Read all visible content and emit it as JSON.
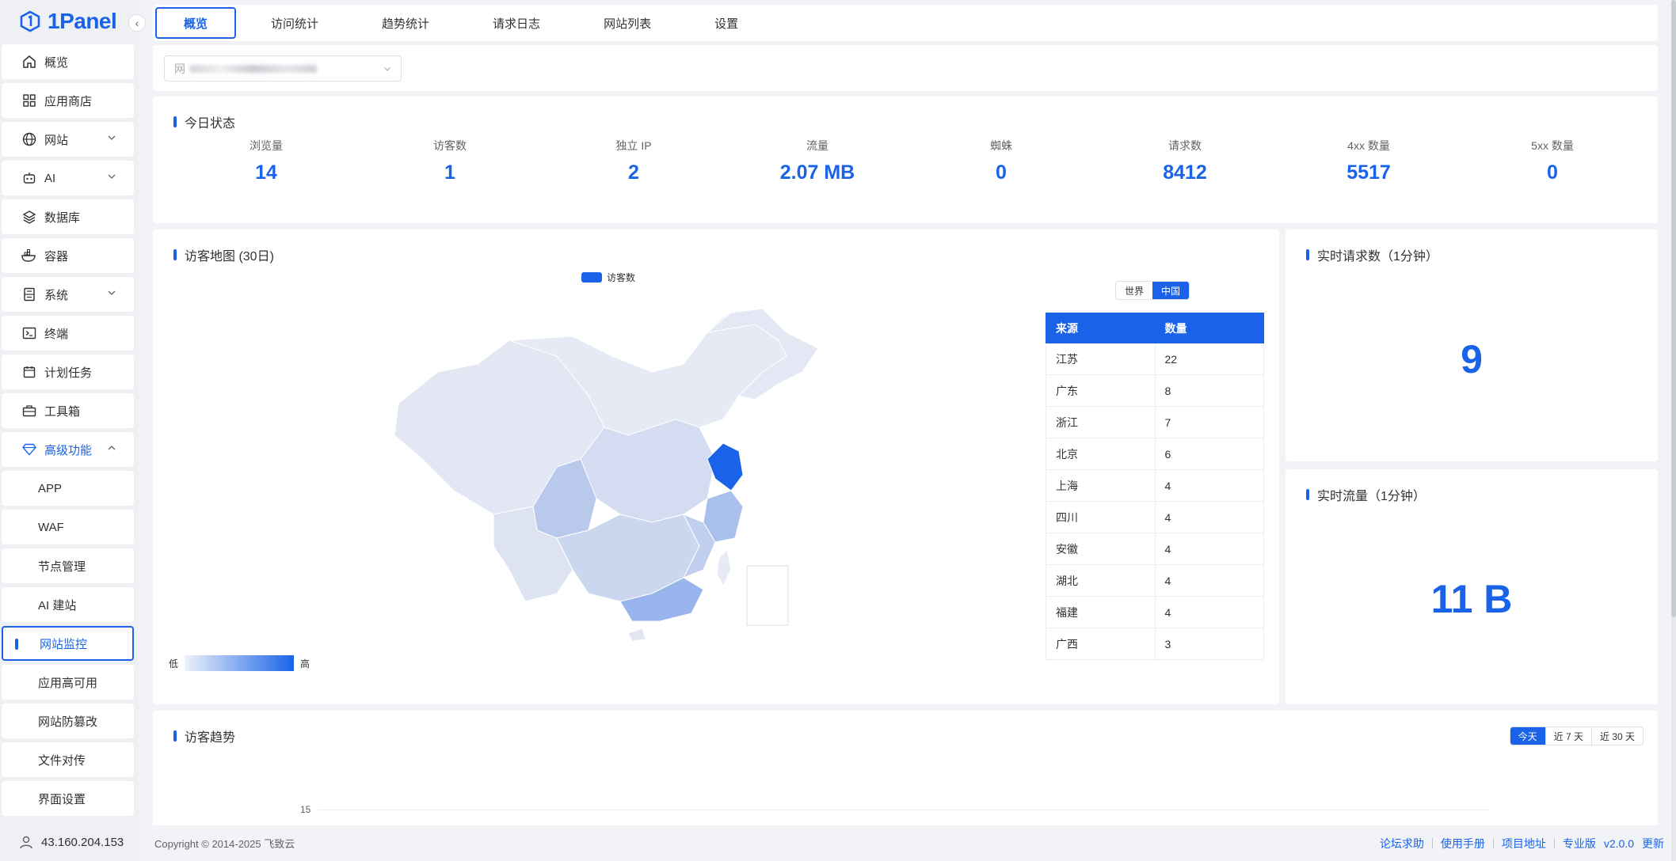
{
  "app": {
    "name": "1Panel",
    "accent": "#1a63e8"
  },
  "sidebar": {
    "items": [
      {
        "label": "概览",
        "icon": "home-icon"
      },
      {
        "label": "应用商店",
        "icon": "grid-icon"
      },
      {
        "label": "网站",
        "icon": "globe-icon",
        "expandable": true
      },
      {
        "label": "AI",
        "icon": "robot-icon",
        "expandable": true
      },
      {
        "label": "数据库",
        "icon": "layers-icon"
      },
      {
        "label": "容器",
        "icon": "docker-icon"
      },
      {
        "label": "系统",
        "icon": "server-icon",
        "expandable": true
      },
      {
        "label": "终端",
        "icon": "terminal-icon"
      },
      {
        "label": "计划任务",
        "icon": "calendar-icon"
      },
      {
        "label": "工具箱",
        "icon": "toolbox-icon"
      },
      {
        "label": "高级功能",
        "icon": "diamond-icon",
        "expanded": true
      }
    ],
    "sub_items": [
      "APP",
      "WAF",
      "节点管理",
      "AI 建站",
      "网站监控",
      "应用高可用",
      "网站防篡改",
      "文件对传",
      "界面设置"
    ],
    "active_sub": "网站监控",
    "ip": "43.160.204.153"
  },
  "tabs": [
    "概览",
    "访问统计",
    "趋势统计",
    "请求日志",
    "网站列表",
    "设置"
  ],
  "active_tab": "概览",
  "site_select": {
    "prefix": "网"
  },
  "today": {
    "title": "今日状态",
    "stats": [
      {
        "label": "浏览量",
        "value": "14"
      },
      {
        "label": "访客数",
        "value": "1"
      },
      {
        "label": "独立 IP",
        "value": "2"
      },
      {
        "label": "流量",
        "value": "2.07 MB"
      },
      {
        "label": "蜘蛛",
        "value": "0"
      },
      {
        "label": "请求数",
        "value": "8412"
      },
      {
        "label": "4xx 数量",
        "value": "5517"
      },
      {
        "label": "5xx 数量",
        "value": "0"
      }
    ]
  },
  "map": {
    "title": "访客地图 (30日)",
    "legend": "访客数",
    "scope_options": [
      "世界",
      "中国"
    ],
    "scope_selected": "中国",
    "range_low": "低",
    "range_high": "高",
    "table_headers": [
      "来源",
      "数量"
    ],
    "rows": [
      {
        "source": "江苏",
        "count": "22"
      },
      {
        "source": "广东",
        "count": "8"
      },
      {
        "source": "浙江",
        "count": "7"
      },
      {
        "source": "北京",
        "count": "6"
      },
      {
        "source": "上海",
        "count": "4"
      },
      {
        "source": "四川",
        "count": "4"
      },
      {
        "source": "安徽",
        "count": "4"
      },
      {
        "source": "湖北",
        "count": "4"
      },
      {
        "source": "福建",
        "count": "4"
      },
      {
        "source": "广西",
        "count": "3"
      }
    ]
  },
  "realtime_requests": {
    "title": "实时请求数（1分钟）",
    "value": "9"
  },
  "realtime_traffic": {
    "title": "实时流量（1分钟）",
    "value": "11 B"
  },
  "trend": {
    "title": "访客趋势",
    "range_options": [
      "今天",
      "近 7 天",
      "近 30 天"
    ],
    "range_selected": "今天",
    "y_tick": "15"
  },
  "footer": {
    "copyright": "Copyright © 2014-2025 飞致云",
    "links": [
      "论坛求助",
      "使用手册",
      "项目地址",
      "专业版"
    ],
    "version": "v2.0.0",
    "update": "更新"
  }
}
